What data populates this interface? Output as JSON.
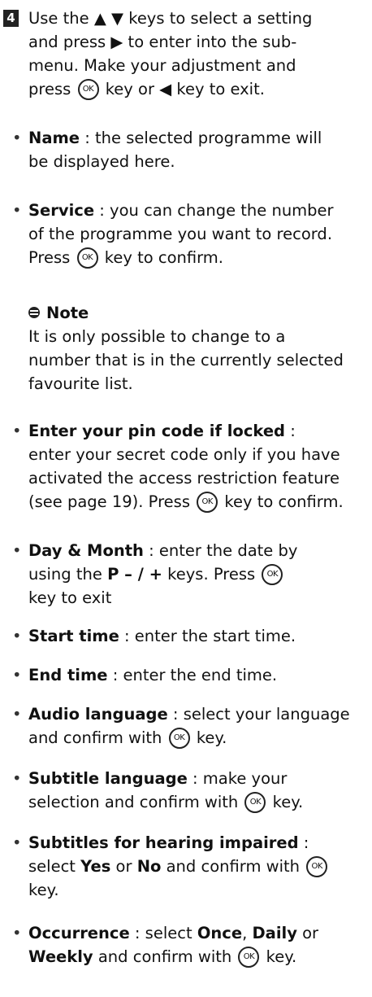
{
  "step": {
    "number": "4",
    "lines": [
      "Use the ▲ ▼ keys to select a setting",
      "and press ▶ to enter into the sub-",
      "menu. Make your adjustment and"
    ],
    "last_pre": "press",
    "last_mid": "key or ◀ key to exit."
  },
  "ok_label": "OK",
  "bullet_char": "•",
  "items": {
    "name": {
      "label": "Name",
      "sep": " : ",
      "line1": "the selected programme will",
      "line2": "be displayed here."
    },
    "service": {
      "label": "Service",
      "sep": " : ",
      "line1": "you can change the number",
      "line2": "of the programme you want to record.",
      "line3_pre": "Press",
      "line3_post": "key to confirm."
    },
    "pin": {
      "label": "Enter your pin code if locked",
      "sep": " :",
      "line2": "enter your secret code only if you have",
      "line3": "activated the access restriction feature",
      "line4_pre": "(see page 19). Press",
      "line4_post": "key to confirm."
    },
    "day": {
      "label": "Day & Month",
      "sep": " : ",
      "line1": "enter the date by",
      "line2_pre": "using the",
      "line2_keys": "P – / +",
      "line2_post": "keys. Press",
      "line3": "key to exit"
    },
    "start": {
      "label": "Start time",
      "sep": " : ",
      "line1": "enter the start time."
    },
    "end": {
      "label": "End time",
      "sep": " : ",
      "line1": "enter the end time."
    },
    "audio": {
      "label": "Audio language",
      "sep": " : ",
      "line1": "select your language",
      "line2_pre": "and confirm with",
      "line2_post": "key."
    },
    "subtitle": {
      "label": "Subtitle language",
      "sep": " : ",
      "line1": "make your",
      "line2_pre": "selection and confirm with",
      "line2_post": "key."
    },
    "hearing": {
      "label": "Subtitles for hearing impaired",
      "sep": " :",
      "line2_pre": "select",
      "yes": "Yes",
      "or": "or",
      "no": "No",
      "line2_post": "and confirm with",
      "line3": "key."
    },
    "occurrence": {
      "label": "Occurrence",
      "sep": " : ",
      "line1_pre": "select",
      "once": "Once",
      "comma": ",",
      "daily": "Daily",
      "or": "or",
      "weekly": "Weekly",
      "line2_post": "and confirm with",
      "line2_end": "key."
    }
  },
  "note": {
    "title": "Note",
    "lines": [
      "It is only possible to change to a",
      "number that is in the currently selected",
      "favourite list."
    ]
  }
}
